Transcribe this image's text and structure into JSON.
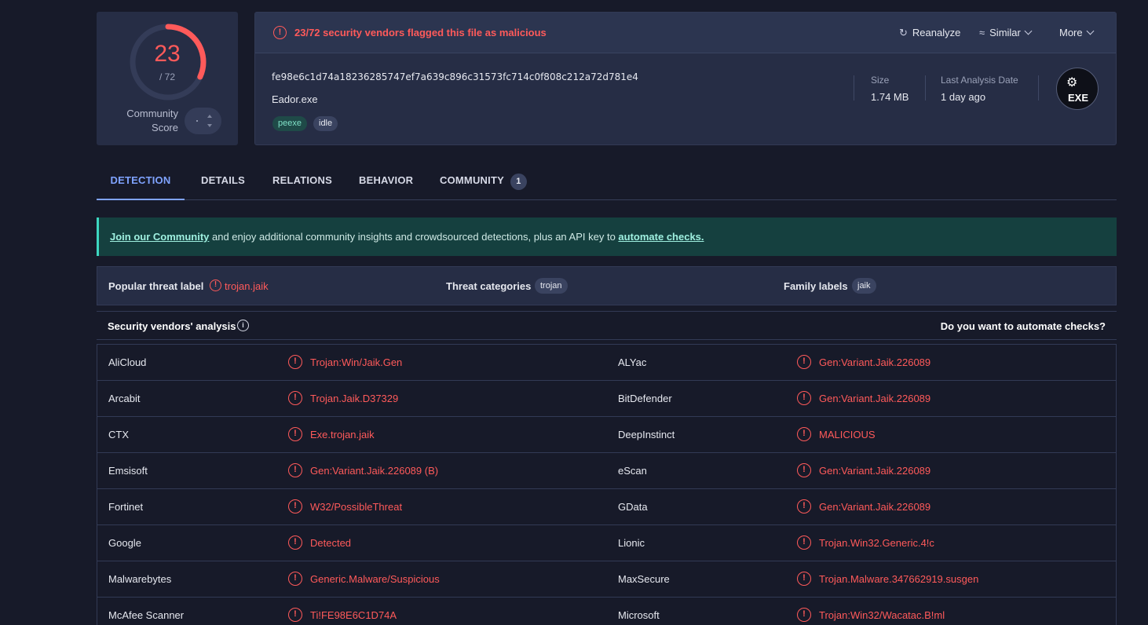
{
  "score": {
    "detections": "23",
    "total": "/ 72",
    "fraction": 0.319,
    "community_label_line1": "Community",
    "community_label_line2": "Score",
    "vote_value": "·"
  },
  "header": {
    "flag_text": "23/72 security vendors flagged this file as malicious",
    "actions": {
      "reanalyze": "Reanalyze",
      "similar": "Similar",
      "more": "More"
    }
  },
  "file": {
    "hash": "fe98e6c1d74a18236285747ef7a639c896c31573fc714c0f808c212a72d781e4",
    "name": "Eador.exe",
    "tags": [
      "peexe",
      "idle"
    ],
    "size_label": "Size",
    "size_value": "1.74 MB",
    "date_label": "Last Analysis Date",
    "date_value": "1 day ago",
    "type_badge": "EXE"
  },
  "tabs": [
    {
      "label": "DETECTION"
    },
    {
      "label": "DETAILS"
    },
    {
      "label": "RELATIONS"
    },
    {
      "label": "BEHAVIOR"
    },
    {
      "label": "COMMUNITY",
      "count": "1"
    }
  ],
  "banner": {
    "link1": "Join our Community",
    "middle": " and enjoy additional community insights and crowdsourced detections, plus an API key to ",
    "link2": "automate checks."
  },
  "threat": {
    "popular_label": "Popular threat label",
    "popular_value": "trojan.jaik",
    "categories_label": "Threat categories",
    "categories_value": "trojan",
    "family_label": "Family labels",
    "family_value": "jaik"
  },
  "analysis": {
    "title": "Security vendors' analysis",
    "automate": "Do you want to automate checks?"
  },
  "vendors": [
    {
      "v1": "AliCloud",
      "r1": "Trojan:Win/Jaik.Gen",
      "v2": "ALYac",
      "r2": "Gen:Variant.Jaik.226089"
    },
    {
      "v1": "Arcabit",
      "r1": "Trojan.Jaik.D37329",
      "v2": "BitDefender",
      "r2": "Gen:Variant.Jaik.226089"
    },
    {
      "v1": "CTX",
      "r1": "Exe.trojan.jaik",
      "v2": "DeepInstinct",
      "r2": "MALICIOUS"
    },
    {
      "v1": "Emsisoft",
      "r1": "Gen:Variant.Jaik.226089 (B)",
      "v2": "eScan",
      "r2": "Gen:Variant.Jaik.226089"
    },
    {
      "v1": "Fortinet",
      "r1": "W32/PossibleThreat",
      "v2": "GData",
      "r2": "Gen:Variant.Jaik.226089"
    },
    {
      "v1": "Google",
      "r1": "Detected",
      "v2": "Lionic",
      "r2": "Trojan.Win32.Generic.4!c"
    },
    {
      "v1": "Malwarebytes",
      "r1": "Generic.Malware/Suspicious",
      "v2": "MaxSecure",
      "r2": "Trojan.Malware.347662919.susgen"
    },
    {
      "v1": "McAfee Scanner",
      "r1": "Ti!FE98E6C1D74A",
      "v2": "Microsoft",
      "r2": "Trojan:Win32/Wacatac.B!ml"
    }
  ]
}
